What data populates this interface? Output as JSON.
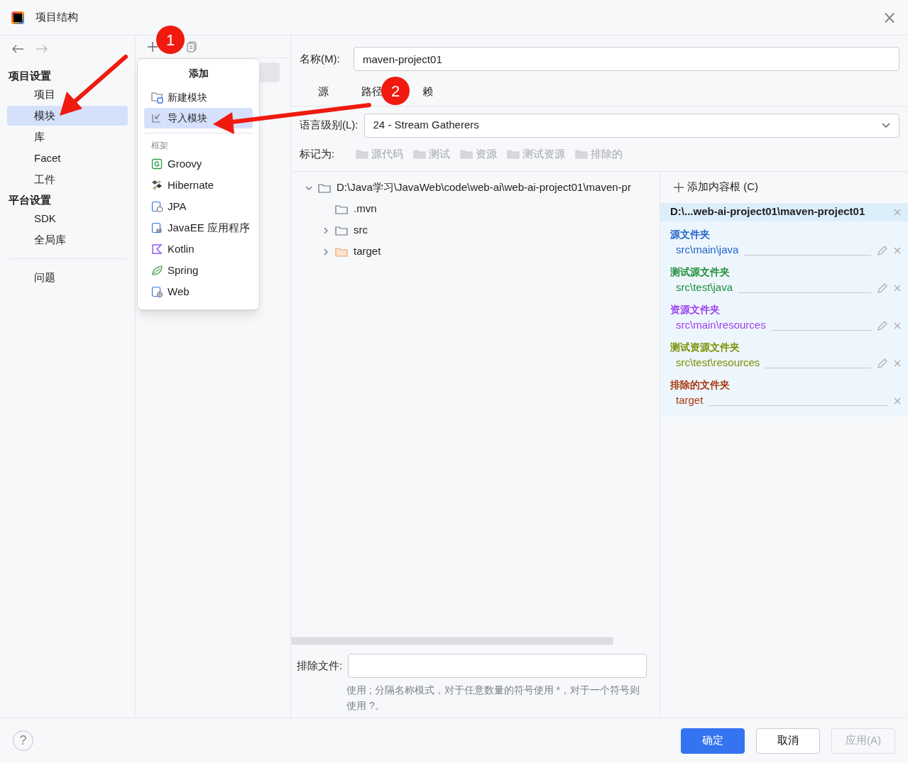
{
  "window": {
    "title": "项目结构",
    "close": "×"
  },
  "sidebar": {
    "sections": [
      {
        "title": "项目设置",
        "items": [
          {
            "label": "项目",
            "selected": false
          },
          {
            "label": "模块",
            "selected": true
          },
          {
            "label": "库",
            "selected": false
          },
          {
            "label": "Facet",
            "selected": false
          },
          {
            "label": "工件",
            "selected": false
          }
        ]
      },
      {
        "title": "平台设置",
        "items": [
          {
            "label": "SDK",
            "selected": false
          },
          {
            "label": "全局库",
            "selected": false
          }
        ]
      }
    ],
    "extra_items": [
      {
        "label": "问题",
        "selected": false
      }
    ]
  },
  "add_menu": {
    "title": "添加",
    "items": [
      {
        "label": "新建模块",
        "kind": "new",
        "selected": false
      },
      {
        "label": "导入模块",
        "kind": "import",
        "selected": true
      }
    ],
    "group_title": "框架",
    "frameworks": [
      {
        "label": "Groovy",
        "kind": "groovy"
      },
      {
        "label": "Hibernate",
        "kind": "hibernate"
      },
      {
        "label": "JPA",
        "kind": "jpa"
      },
      {
        "label": "JavaEE 应用程序",
        "kind": "javaee"
      },
      {
        "label": "Kotlin",
        "kind": "kotlin"
      },
      {
        "label": "Spring",
        "kind": "spring"
      },
      {
        "label": "Web",
        "kind": "web"
      }
    ]
  },
  "name_field": {
    "label": "名称(M):",
    "value": "maven-project01"
  },
  "tabs": [
    {
      "label": "源"
    },
    {
      "label": "路径"
    },
    {
      "label": "赖"
    }
  ],
  "language_level": {
    "label": "语言级别(L):",
    "value": "24 - Stream Gatherers"
  },
  "mark_as": {
    "label": "标记为:",
    "buttons": [
      "源代码",
      "测试",
      "资源",
      "测试资源",
      "排除的"
    ]
  },
  "tree": [
    {
      "label": "D:\\Java学习\\JavaWeb\\code\\web-ai\\web-ai-project01\\maven-pr",
      "expanded": true,
      "excluded": false,
      "children": [
        {
          "label": ".mvn",
          "excluded": false
        },
        {
          "label": "src",
          "expanded": false,
          "excluded": false
        },
        {
          "label": "target",
          "expanded": false,
          "excluded": true
        }
      ]
    }
  ],
  "content_root": {
    "add_label": "添加内容根 (C)",
    "path": "D:\\...web-ai-project01\\maven-project01",
    "folders": [
      {
        "title": "源文件夹",
        "path": "src\\main\\java",
        "color": "#2563c9",
        "editable": true
      },
      {
        "title": "测试源文件夹",
        "path": "src\\test\\java",
        "color": "#1f8f3a",
        "editable": true
      },
      {
        "title": "资源文件夹",
        "path": "src\\main\\resources",
        "color": "#9b3ff0",
        "editable": true
      },
      {
        "title": "测试资源文件夹",
        "path": "src\\test\\resources",
        "color": "#7a8f00",
        "editable": true
      },
      {
        "title": "排除的文件夹",
        "path": "target",
        "color": "#a8380c",
        "editable": false
      }
    ]
  },
  "exclude_files": {
    "label": "排除文件:",
    "hint": "使用 ; 分隔名称模式，对于任意数量的符号使用 *，对于一个符号则使用 ?。"
  },
  "footer": {
    "help": "?",
    "buttons": [
      {
        "label": "确定",
        "kind": "primary"
      },
      {
        "label": "取消",
        "kind": "normal"
      },
      {
        "label": "应用(A)",
        "kind": "disabled"
      }
    ]
  },
  "annotations": [
    {
      "label": "1"
    },
    {
      "label": "2"
    }
  ]
}
